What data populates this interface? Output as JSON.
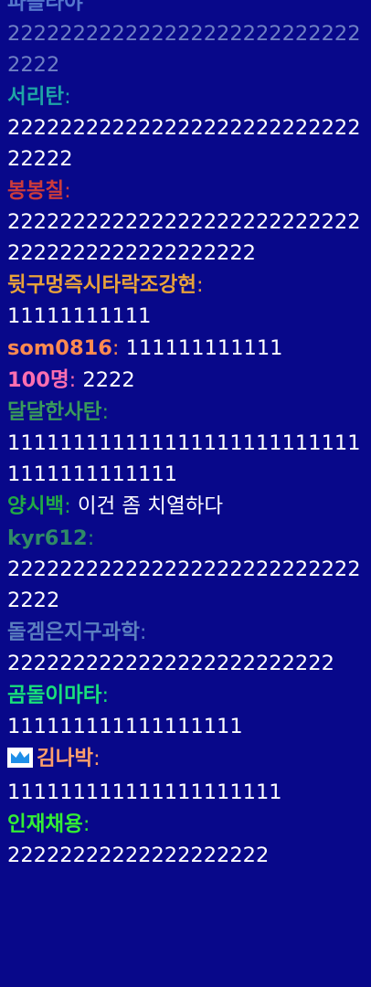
{
  "messages": [
    {
      "name": "파블라야",
      "color": "#5577cc",
      "text": "2222222222222222222222222222222",
      "text_color": "#6f80c4",
      "faded": true
    },
    {
      "name": "서리탄",
      "color": "#1fa5a5",
      "text": "22222222222222222222222222222222"
    },
    {
      "name": "봉봉칠",
      "color": "#cc3b3b",
      "text": "2222222222222222222222222222222222222222222222"
    },
    {
      "name": "뒷구멍즉시타락조강현",
      "color": "#e8a23a",
      "text": "11111111111"
    },
    {
      "name": "som0816",
      "color": "#ff8a50",
      "text": "111111111111",
      "inline": true
    },
    {
      "name": "100명",
      "color": "#ff6fb0",
      "text": "2222",
      "inline": true
    },
    {
      "name": "달달한사탄",
      "color": "#3a9a5a",
      "text": "1111111111111111111111111111111111111111"
    },
    {
      "name": "양시백",
      "color": "#22aa44",
      "text": "이건 좀 치열하다",
      "inline": true
    },
    {
      "name": "kyr612",
      "color": "#2f8a66",
      "text": "2222222222222222222222222222222"
    },
    {
      "name": "돌겜은지구과학",
      "color": "#5b7fbf",
      "text": "2222222222222222222222222"
    },
    {
      "name": "곰돌이마타",
      "color": "#19e07a",
      "text": "111111111111111111"
    },
    {
      "name": "김나박",
      "color": "#ff9f6a",
      "text": "111111111111111111111",
      "badge": "crown-icon"
    },
    {
      "name": "인재채용",
      "color": "#33ee33",
      "text": "22222222222222222222"
    }
  ],
  "colon": ":"
}
